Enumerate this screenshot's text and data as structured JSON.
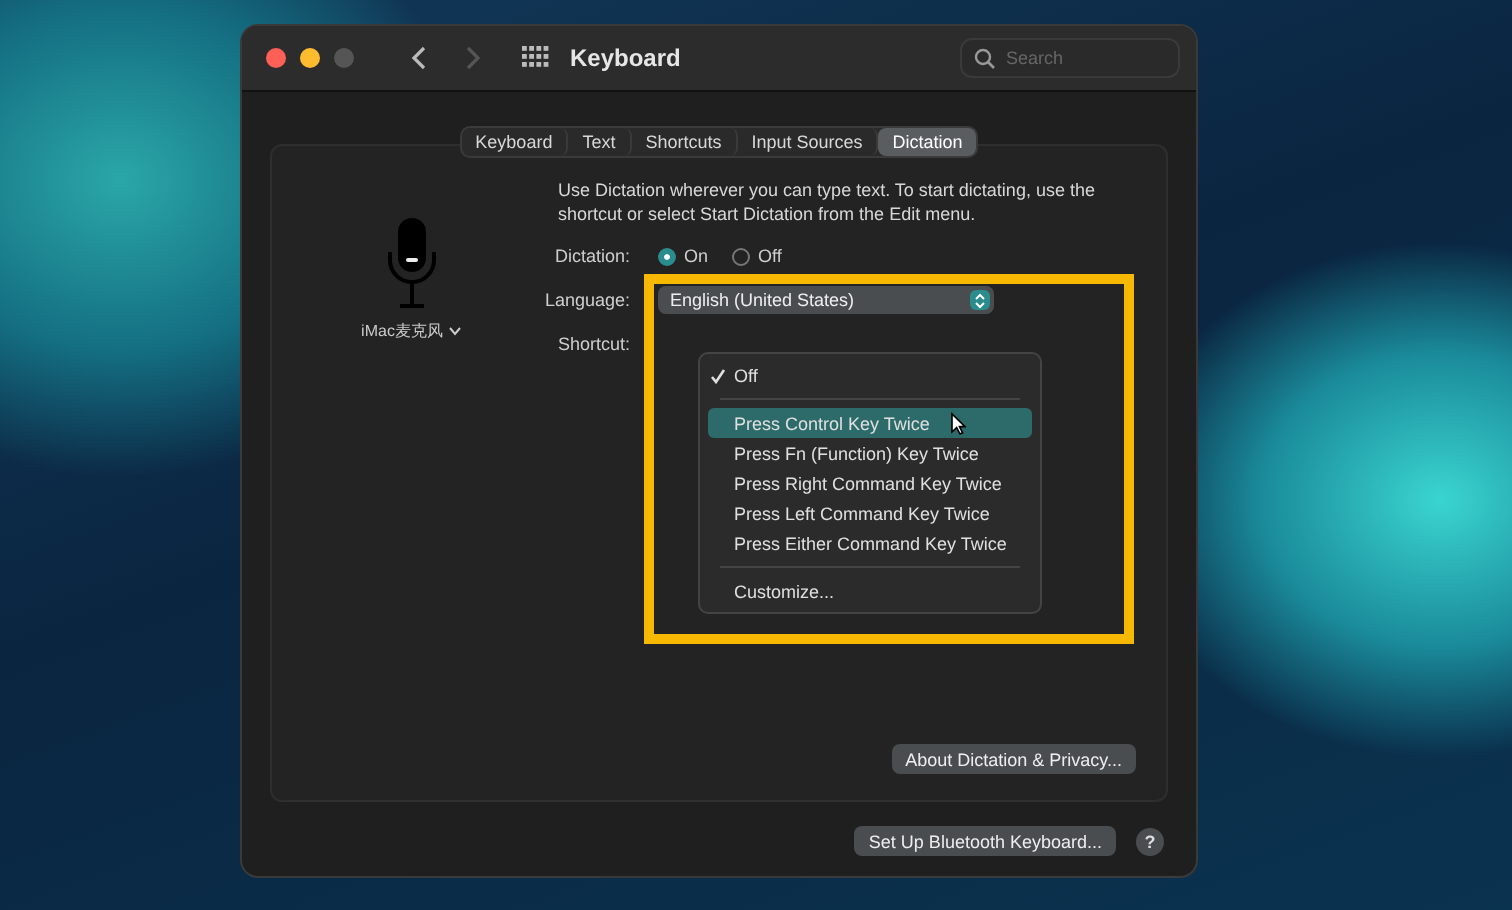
{
  "window": {
    "title": "Keyboard",
    "search": {
      "placeholder": "Search"
    }
  },
  "tabs": [
    {
      "label": "Keyboard",
      "selected": false
    },
    {
      "label": "Text",
      "selected": false
    },
    {
      "label": "Shortcuts",
      "selected": false
    },
    {
      "label": "Input Sources",
      "selected": false
    },
    {
      "label": "Dictation",
      "selected": true
    }
  ],
  "microphone": {
    "label": "iMac麦克风"
  },
  "description": "Use Dictation wherever you can type text. To start dictating, use the shortcut or select Start Dictation from the Edit menu.",
  "dictation": {
    "label": "Dictation:",
    "options": [
      {
        "label": "On",
        "selected": true
      },
      {
        "label": "Off",
        "selected": false
      }
    ]
  },
  "language": {
    "label": "Language:",
    "value": "English (United States)"
  },
  "shortcut": {
    "label": "Shortcut:"
  },
  "shortcut_menu": {
    "groups": [
      [
        {
          "label": "Off",
          "checked": true,
          "selected": false
        }
      ],
      [
        {
          "label": "Press Control Key Twice",
          "checked": false,
          "selected": true
        },
        {
          "label": "Press Fn (Function) Key Twice",
          "checked": false,
          "selected": false
        },
        {
          "label": "Press Right Command Key Twice",
          "checked": false,
          "selected": false
        },
        {
          "label": "Press Left Command Key Twice",
          "checked": false,
          "selected": false
        },
        {
          "label": "Press Either Command Key Twice",
          "checked": false,
          "selected": false
        }
      ],
      [
        {
          "label": "Customize...",
          "checked": false,
          "selected": false
        }
      ]
    ]
  },
  "about_button": "About Dictation & Privacy...",
  "setup_button": "Set Up Bluetooth Keyboard...",
  "help_button": "?",
  "highlight": {
    "shown": true
  }
}
